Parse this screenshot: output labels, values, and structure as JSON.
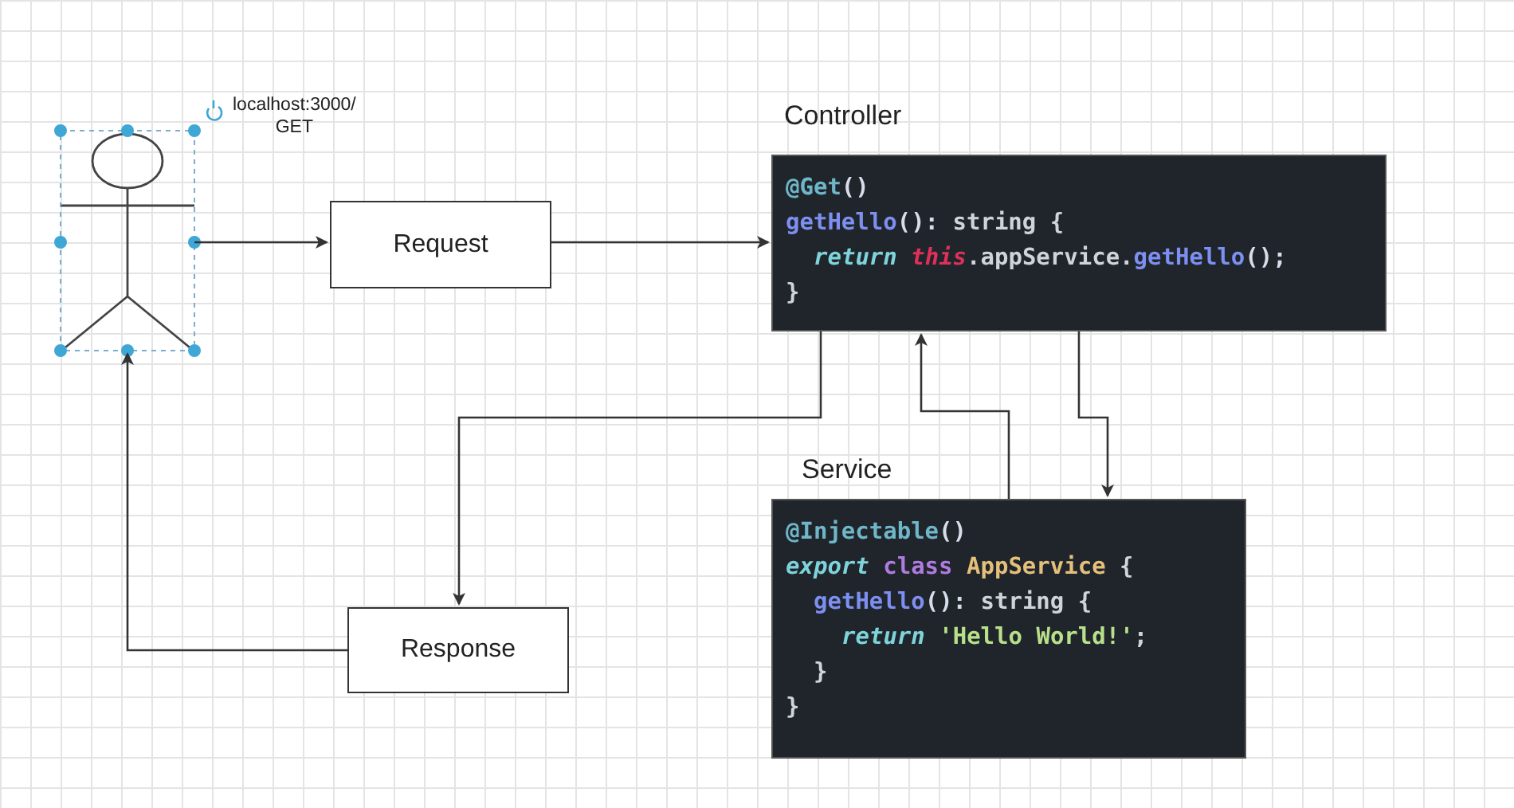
{
  "actor": {
    "selected": true,
    "label_lines": [
      "localhost:3000/",
      "GET"
    ]
  },
  "process_boxes": [
    {
      "label": "Request"
    },
    {
      "label": "Response"
    }
  ],
  "code_panels": [
    {
      "title": "Controller",
      "lines": [
        {
          "tokens": [
            {
              "kind": "decorator",
              "text": "@Get"
            },
            {
              "kind": "punct",
              "text": "()"
            }
          ]
        },
        {
          "tokens": [
            {
              "kind": "fn",
              "text": "getHello"
            },
            {
              "kind": "punct",
              "text": "(): "
            },
            {
              "kind": "plain",
              "text": "string {"
            }
          ],
          "children": [
            {
              "tokens": [
                {
                  "kind": "keyword",
                  "text": "return "
                },
                {
                  "kind": "this",
                  "text": "this"
                },
                {
                  "kind": "plain",
                  "text": ".appService."
                },
                {
                  "kind": "fn",
                  "text": "getHello"
                },
                {
                  "kind": "punct",
                  "text": "();"
                }
              ]
            }
          ]
        },
        {
          "tokens": [
            {
              "kind": "plain",
              "text": "}"
            }
          ]
        }
      ]
    },
    {
      "title": "Service",
      "lines": [
        {
          "tokens": [
            {
              "kind": "decorator",
              "text": "@Injectable"
            },
            {
              "kind": "punct",
              "text": "()"
            }
          ]
        },
        {
          "tokens": [
            {
              "kind": "keyword",
              "text": "export "
            },
            {
              "kind": "storage",
              "text": "class "
            },
            {
              "kind": "classname",
              "text": "AppService"
            },
            {
              "kind": "plain",
              "text": " {"
            }
          ],
          "children": [
            {
              "tokens": [
                {
                  "kind": "fn",
                  "text": "getHello"
                },
                {
                  "kind": "punct",
                  "text": "(): "
                },
                {
                  "kind": "plain",
                  "text": "string {"
                }
              ],
              "children": [
                {
                  "tokens": [
                    {
                      "kind": "keyword",
                      "text": "return "
                    },
                    {
                      "kind": "string",
                      "text": "'Hello World!'"
                    },
                    {
                      "kind": "plain",
                      "text": ";"
                    }
                  ]
                }
              ]
            },
            {
              "tokens": [
                {
                  "kind": "plain",
                  "text": "}"
                }
              ]
            }
          ]
        },
        {
          "tokens": [
            {
              "kind": "plain",
              "text": "}"
            }
          ]
        }
      ]
    }
  ]
}
